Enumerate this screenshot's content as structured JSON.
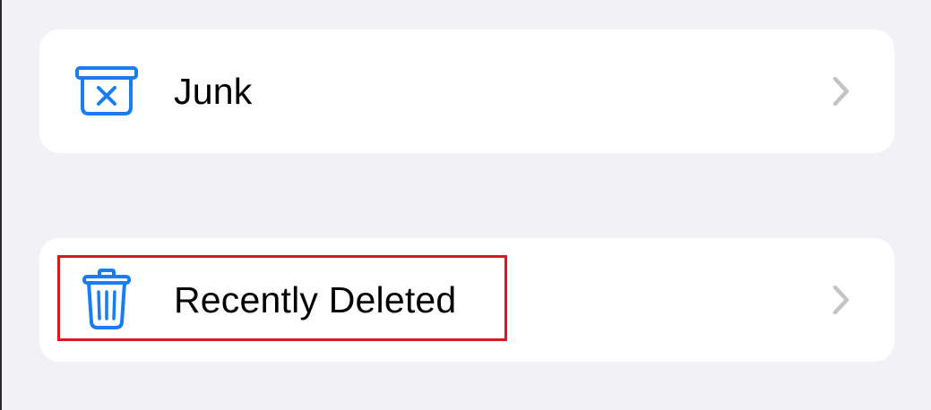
{
  "colors": {
    "background": "#f1f1f6",
    "card": "#ffffff",
    "icon_blue": "#1a7cf2",
    "chevron": "#c4c4c8",
    "highlight": "#e0151c"
  },
  "mailboxes": [
    {
      "label": "Junk",
      "icon": "junk-icon"
    },
    {
      "label": "Recently Deleted",
      "icon": "trash-icon"
    }
  ]
}
